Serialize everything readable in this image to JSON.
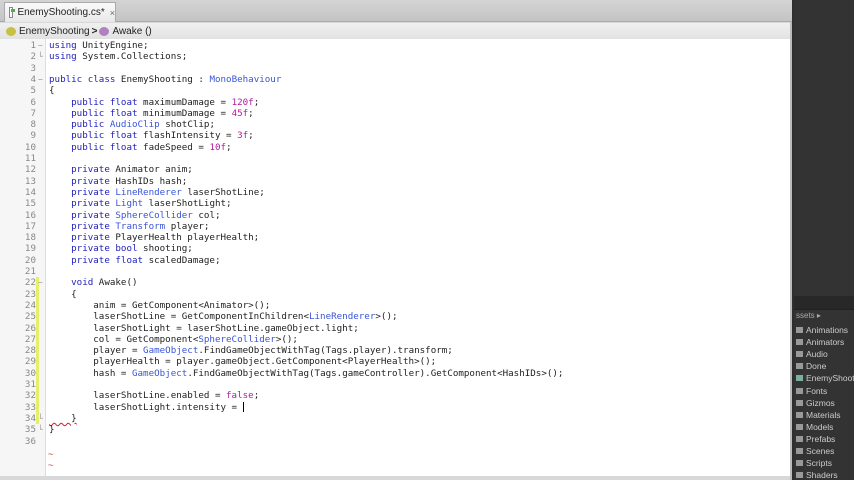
{
  "tab": {
    "title": "EnemyShooting.cs*",
    "close": "×"
  },
  "breadcrumb": {
    "class_name": "EnemyShooting",
    "separator": ">",
    "method": "Awake ()"
  },
  "code": [
    [
      [
        "using",
        "k"
      ],
      [
        " UnityEngine;",
        ""
      ]
    ],
    [
      [
        "using",
        "k"
      ],
      [
        " System.Collections;",
        ""
      ]
    ],
    [],
    [
      [
        "public class",
        "k"
      ],
      [
        " EnemyShooting : ",
        ""
      ],
      [
        "MonoBehaviour",
        "t"
      ]
    ],
    [
      [
        "{",
        ""
      ]
    ],
    [
      [
        "    public float",
        "k"
      ],
      [
        " maximumDamage = ",
        ""
      ],
      [
        "120f",
        "n"
      ],
      [
        ";",
        ""
      ]
    ],
    [
      [
        "    public float",
        "k"
      ],
      [
        " minimumDamage = ",
        ""
      ],
      [
        "45f",
        "n"
      ],
      [
        ";",
        ""
      ]
    ],
    [
      [
        "    public ",
        "k"
      ],
      [
        "AudioClip",
        "t"
      ],
      [
        " shotClip;",
        ""
      ]
    ],
    [
      [
        "    public float",
        "k"
      ],
      [
        " flashIntensity = ",
        ""
      ],
      [
        "3f",
        "n"
      ],
      [
        ";",
        ""
      ]
    ],
    [
      [
        "    public float",
        "k"
      ],
      [
        " fadeSpeed = ",
        ""
      ],
      [
        "10f",
        "n"
      ],
      [
        ";",
        ""
      ]
    ],
    [],
    [
      [
        "    private",
        "k"
      ],
      [
        " Animator anim;",
        ""
      ]
    ],
    [
      [
        "    private",
        "k"
      ],
      [
        " HashIDs hash;",
        ""
      ]
    ],
    [
      [
        "    private ",
        "k"
      ],
      [
        "LineRenderer",
        "t"
      ],
      [
        " laserShotLine;",
        ""
      ]
    ],
    [
      [
        "    private ",
        "k"
      ],
      [
        "Light",
        "t"
      ],
      [
        " laserShotLight;",
        ""
      ]
    ],
    [
      [
        "    private ",
        "k"
      ],
      [
        "SphereCollider",
        "t"
      ],
      [
        " col;",
        ""
      ]
    ],
    [
      [
        "    private ",
        "k"
      ],
      [
        "Transform",
        "t"
      ],
      [
        " player;",
        ""
      ]
    ],
    [
      [
        "    private",
        "k"
      ],
      [
        " PlayerHealth playerHealth;",
        ""
      ]
    ],
    [
      [
        "    private bool",
        "k"
      ],
      [
        " shooting;",
        ""
      ]
    ],
    [
      [
        "    private float",
        "k"
      ],
      [
        " scaledDamage;",
        ""
      ]
    ],
    [],
    [
      [
        "    void",
        "k"
      ],
      [
        " Awake()",
        ""
      ]
    ],
    [
      [
        "    {",
        ""
      ]
    ],
    [
      [
        "        anim = GetComponent<Animator>();",
        ""
      ]
    ],
    [
      [
        "        laserShotLine = GetComponentInChildren<",
        ""
      ],
      [
        "LineRenderer",
        "t"
      ],
      [
        ">();",
        ""
      ]
    ],
    [
      [
        "        laserShotLight = laserShotLine.gameObject.light;",
        ""
      ]
    ],
    [
      [
        "        col = GetComponent<",
        ""
      ],
      [
        "SphereCollider",
        "t"
      ],
      [
        ">();",
        ""
      ]
    ],
    [
      [
        "        player = ",
        ""
      ],
      [
        "GameObject",
        "t"
      ],
      [
        ".FindGameObjectWithTag(Tags.player).transform;",
        ""
      ]
    ],
    [
      [
        "        playerHealth = player.gameObject.GetComponent<PlayerHealth>();",
        ""
      ]
    ],
    [
      [
        "        hash = ",
        ""
      ],
      [
        "GameObject",
        "t"
      ],
      [
        ".FindGameObjectWithTag(Tags.gameController).GetComponent<HashIDs>();",
        ""
      ]
    ],
    [],
    [
      [
        "        laserShotLine.enabled = ",
        ""
      ],
      [
        "false",
        "n"
      ],
      [
        ";",
        ""
      ]
    ],
    [
      [
        "        laserShotLight.intensity = ",
        ""
      ]
    ],
    [
      [
        "    }",
        "err"
      ]
    ],
    [
      [
        "}",
        ""
      ]
    ],
    []
  ],
  "eof_markers": [
    "~",
    "~"
  ],
  "project_panel": {
    "header": "ssets ▸",
    "items": [
      "Animations",
      "Animators",
      "Audio",
      "Done",
      "EnemyShoot",
      "Fonts",
      "Gizmos",
      "Materials",
      "Models",
      "Prefabs",
      "Scenes",
      "Scripts",
      "Shaders"
    ]
  }
}
